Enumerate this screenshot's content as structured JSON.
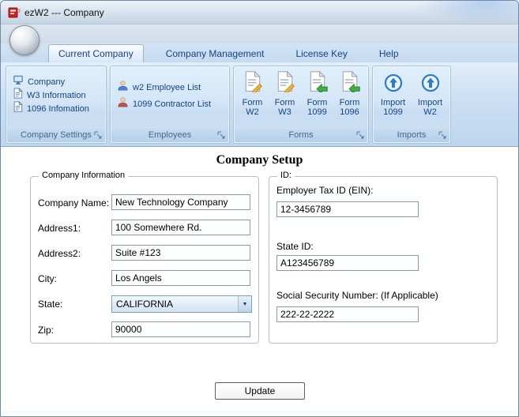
{
  "window": {
    "title": "ezW2 --- Company"
  },
  "tabs": {
    "current_company": "Current Company",
    "company_management": "Company Management",
    "license_key": "License Key",
    "help": "Help"
  },
  "ribbon": {
    "company_settings": {
      "label": "Company Settings",
      "items": [
        {
          "label": "Company"
        },
        {
          "label": "W3 Information"
        },
        {
          "label": "1096 Infomation"
        }
      ]
    },
    "employees": {
      "label": "Employees",
      "items": [
        {
          "label": "w2 Employee List"
        },
        {
          "label": "1099 Contractor List"
        }
      ]
    },
    "forms": {
      "label": "Forms",
      "items": [
        {
          "line1": "Form",
          "line2": "W2"
        },
        {
          "line1": "Form",
          "line2": "W3"
        },
        {
          "line1": "Form",
          "line2": "1099"
        },
        {
          "line1": "Form",
          "line2": "1096"
        }
      ]
    },
    "imports": {
      "label": "Imports",
      "items": [
        {
          "line1": "Import",
          "line2": "1099"
        },
        {
          "line1": "Import",
          "line2": "W2"
        }
      ]
    }
  },
  "main": {
    "title": "Company Setup",
    "company_info": {
      "legend": "Company Information",
      "company_name": {
        "label": "Company Name:",
        "value": "New Technology Company"
      },
      "address1": {
        "label": "Address1:",
        "value": "100 Somewhere Rd."
      },
      "address2": {
        "label": "Address2:",
        "value": "Suite #123"
      },
      "city": {
        "label": "City:",
        "value": "Los Angels"
      },
      "state": {
        "label": "State:",
        "value": "CALIFORNIA"
      },
      "zip": {
        "label": "Zip:",
        "value": "90000"
      }
    },
    "ids": {
      "legend": "ID:",
      "ein": {
        "label": "Employer Tax ID (EIN):",
        "value": "12-3456789"
      },
      "state_id": {
        "label": "State ID:",
        "value": "A123456789"
      },
      "ssn": {
        "label": "Social Security Number: (If Applicable)",
        "value": "222-22-2222"
      }
    },
    "update_button": "Update"
  },
  "colors": {
    "accent_blue": "#15428b",
    "ribbon_bg": "#cadff3",
    "selection": "#7f9db9"
  }
}
